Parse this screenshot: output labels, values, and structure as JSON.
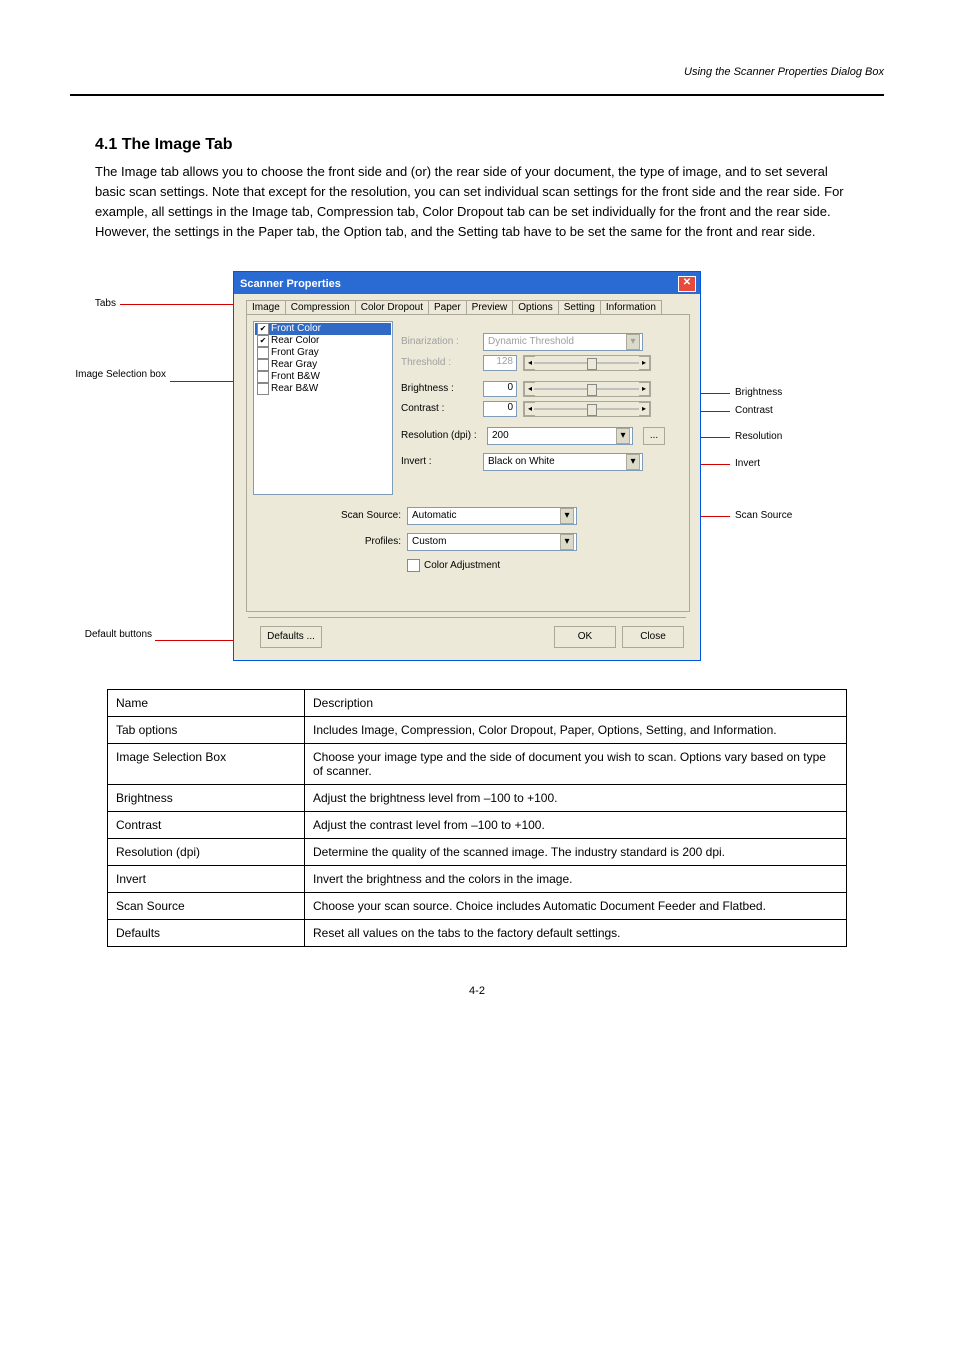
{
  "header": {
    "left": "",
    "right": "Using the Scanner Properties Dialog Box"
  },
  "section_title": "4.1 The Image Tab",
  "intro_para": "The Image tab allows you to choose the front side and (or) the rear side of your document, the type of image, and to set several basic scan settings.  Note that except for the resolution, you can set individual scan settings for the front side and the rear side.  For example, all settings in the Image tab, Compression tab, Color Dropout tab can be set individually for the front and the rear side.  However, the settings in the Paper tab, the Option tab, and the Setting tab have to be set the same for the front and rear side.",
  "dialog": {
    "title": "Scanner Properties",
    "tabs": [
      "Image",
      "Compression",
      "Color Dropout",
      "Paper",
      "Preview",
      "Options",
      "Setting",
      "Information"
    ],
    "active_tab": "Image",
    "selection_items": [
      {
        "label": "Front Color",
        "checked": true,
        "selected": true
      },
      {
        "label": "Rear Color",
        "checked": true
      },
      {
        "label": "Front Gray",
        "checked": false
      },
      {
        "label": "Rear Gray",
        "checked": false
      },
      {
        "label": "Front B&W",
        "checked": false
      },
      {
        "label": "Rear B&W",
        "checked": false
      }
    ],
    "fields": {
      "binarization_label": "Binarization :",
      "binarization_value": "Dynamic Threshold",
      "threshold_label": "Threshold :",
      "threshold_value": "128",
      "brightness_label": "Brightness :",
      "brightness_value": "0",
      "contrast_label": "Contrast   :",
      "contrast_value": "0",
      "resolution_label": "Resolution (dpi) :",
      "resolution_value": "200",
      "invert_label": "Invert :",
      "invert_value": "Black on White",
      "scan_source_label": "Scan Source:",
      "scan_source_value": "Automatic",
      "profiles_label": "Profiles:",
      "profiles_value": "Custom",
      "color_adjustment_label": "Color Adjustment"
    },
    "buttons": {
      "defaults": "Defaults ...",
      "ok": "OK",
      "close": "Close"
    }
  },
  "callouts": {
    "left1": "Tabs",
    "left2": "Image Selection box",
    "left3": "Default buttons",
    "r1": "Brightness",
    "r2": "Contrast",
    "r3": "Resolution",
    "r4": "Invert",
    "r5": "Scan Source"
  },
  "table": {
    "header": [
      "Name",
      "Description"
    ],
    "rows": [
      [
        "Tab options",
        "Includes Image, Compression, Color Dropout, Paper, Options, Setting, and Information."
      ],
      [
        "Image Selection Box",
        "Choose your image type and the side of document you wish to scan. Options vary based on type of scanner."
      ],
      [
        "Brightness",
        "Adjust the brightness level from –100 to +100."
      ],
      [
        "Contrast",
        "Adjust the contrast level from –100 to +100."
      ],
      [
        "Resolution (dpi)",
        "Determine the quality of the scanned image.  The industry standard is 200 dpi."
      ],
      [
        "Invert",
        "Invert  the brightness and the colors in the image."
      ],
      [
        "Scan Source",
        "Choose your scan source. Choice includes Automatic Document Feeder and Flatbed."
      ],
      [
        "Defaults",
        "Reset all values on the tabs to the factory default settings."
      ]
    ]
  },
  "page_number": "4-2"
}
